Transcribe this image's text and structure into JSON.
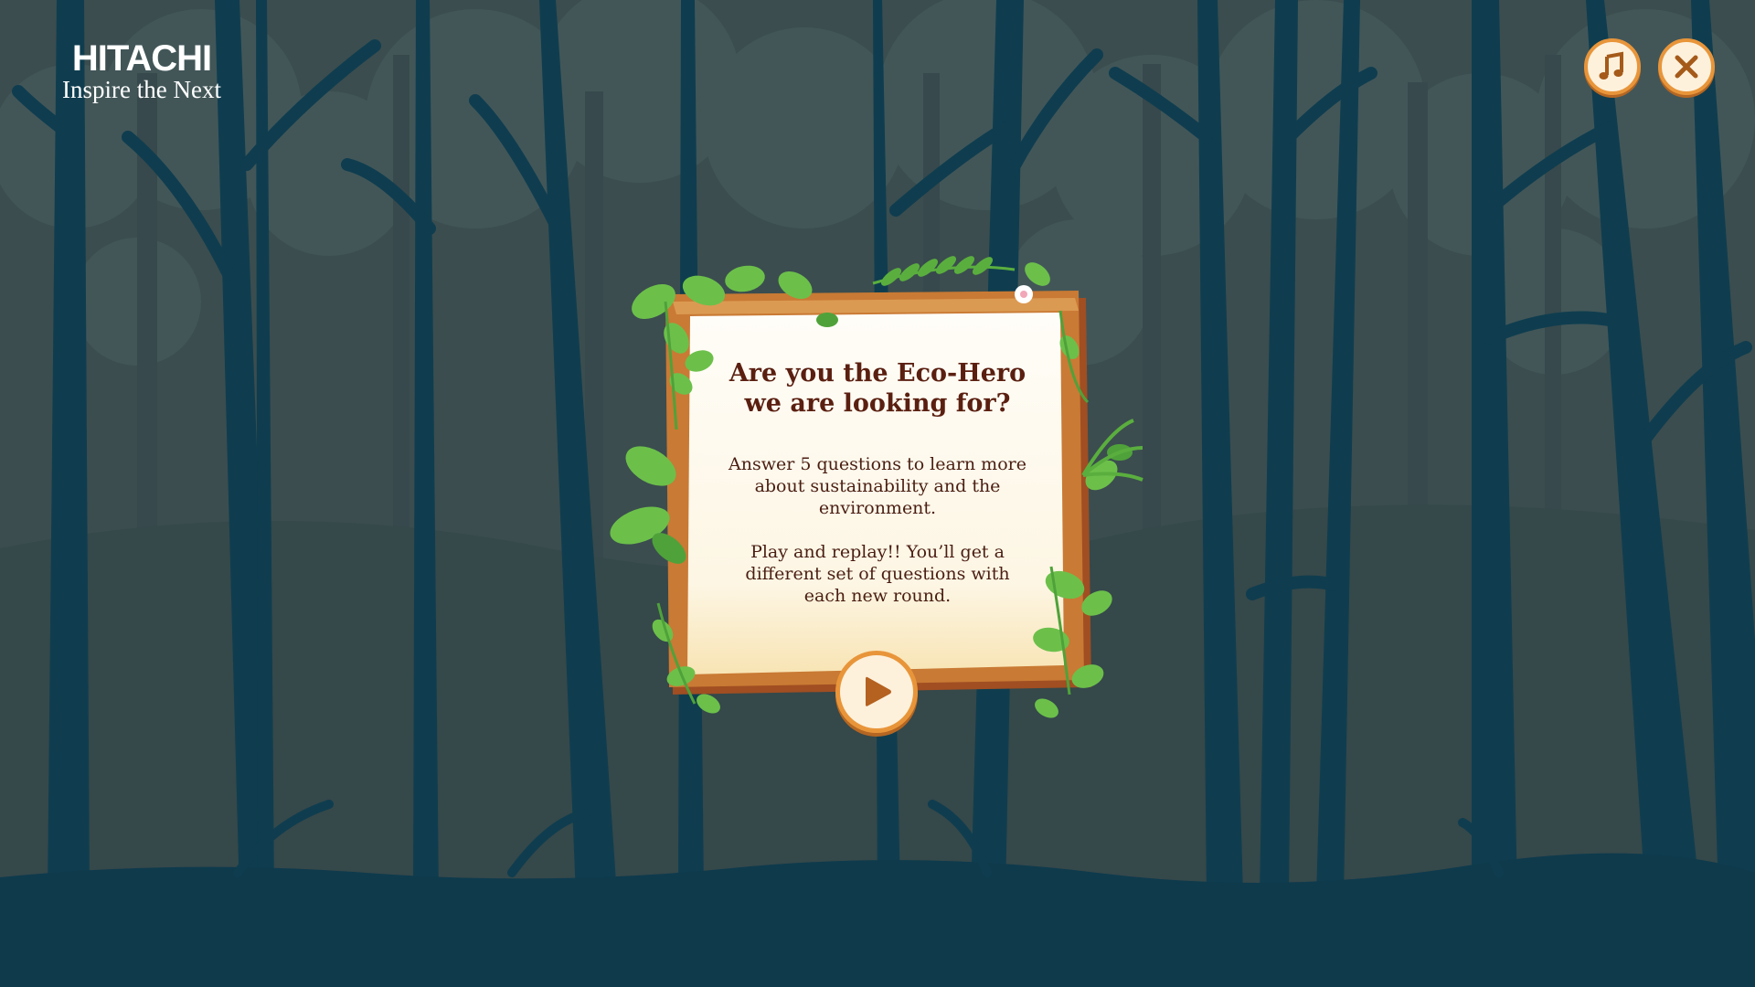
{
  "logo": {
    "brand": "HITACHI",
    "tagline": "Inspire the Next"
  },
  "controls": {
    "music_icon": "music-note-icon",
    "close_icon": "close-icon"
  },
  "panel": {
    "title_line1": "Are you the Eco-Hero",
    "title_line2": "we are looking for?",
    "paragraph1_line1": "Answer 5 questions to learn more",
    "paragraph1_line2": "about sustainability and the",
    "paragraph1_line3": "environment.",
    "paragraph2_line1": "Play and replay!! You’ll get a",
    "paragraph2_line2": "different set of questions with",
    "paragraph2_line3": "each new round.",
    "play_icon": "play-icon"
  },
  "colors": {
    "background": "#3b4d4f",
    "tree_silhouette": "#0f3d4f",
    "ground": "#0e3a4c",
    "button_ring": "#e8953a",
    "button_fill": "#fdf1dc",
    "title_text": "#5a1f10",
    "wood": "#c97a34",
    "paper": "#fdf6e6",
    "leaf": "#6cc04a"
  }
}
